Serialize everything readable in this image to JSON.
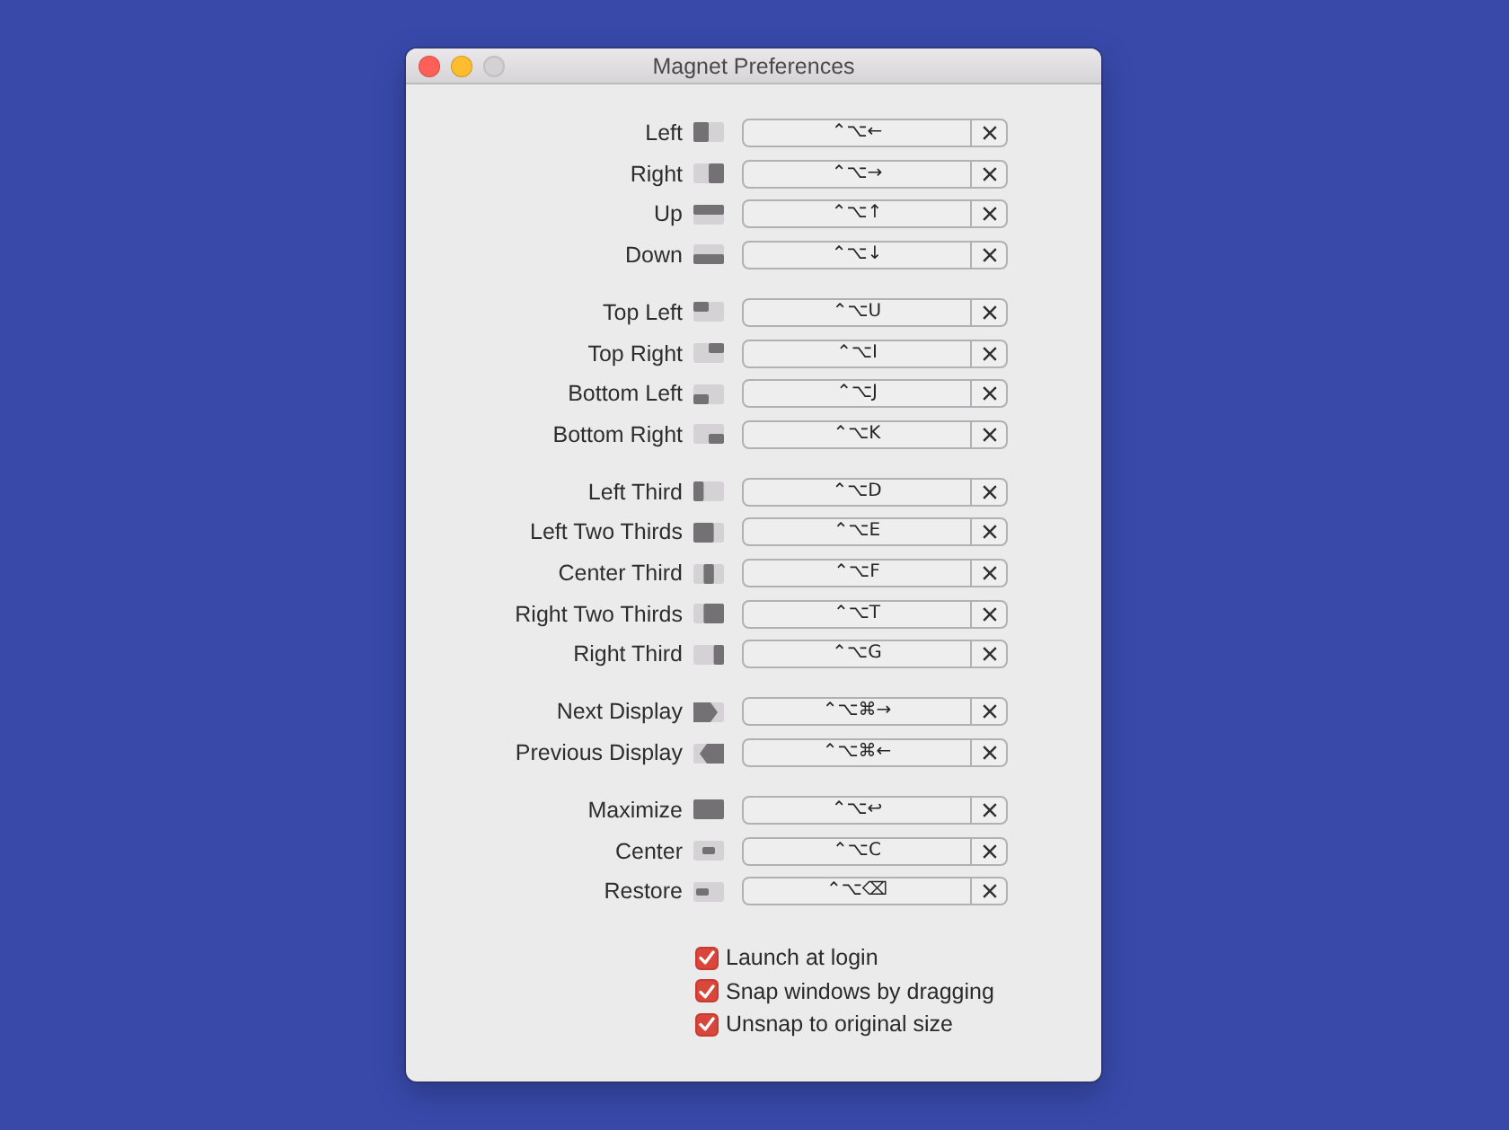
{
  "window": {
    "title": "Magnet Preferences",
    "controls": [
      {
        "kind": "close",
        "disabled": false
      },
      {
        "kind": "minimize",
        "disabled": false
      },
      {
        "kind": "zoom",
        "disabled": true
      }
    ]
  },
  "shortcut_groups": [
    {
      "items": [
        {
          "label": "Left",
          "shortcut": "⌃⌥←"
        },
        {
          "label": "Right",
          "shortcut": "⌃⌥→"
        },
        {
          "label": "Up",
          "shortcut": "⌃⌥↑"
        },
        {
          "label": "Down",
          "shortcut": "⌃⌥↓"
        }
      ]
    },
    {
      "items": [
        {
          "label": "Top Left",
          "shortcut": "⌃⌥U"
        },
        {
          "label": "Top Right",
          "shortcut": "⌃⌥I"
        },
        {
          "label": "Bottom Left",
          "shortcut": "⌃⌥J"
        },
        {
          "label": "Bottom Right",
          "shortcut": "⌃⌥K"
        }
      ]
    },
    {
      "items": [
        {
          "label": "Left Third",
          "shortcut": "⌃⌥D"
        },
        {
          "label": "Left Two Thirds",
          "shortcut": "⌃⌥E"
        },
        {
          "label": "Center Third",
          "shortcut": "⌃⌥F"
        },
        {
          "label": "Right Two Thirds",
          "shortcut": "⌃⌥T"
        },
        {
          "label": "Right Third",
          "shortcut": "⌃⌥G"
        }
      ]
    },
    {
      "items": [
        {
          "label": "Next Display",
          "shortcut": "⌃⌥⌘→"
        },
        {
          "label": "Previous Display",
          "shortcut": "⌃⌥⌘←"
        }
      ]
    },
    {
      "items": [
        {
          "label": "Maximize",
          "shortcut": "⌃⌥↩"
        },
        {
          "label": "Center",
          "shortcut": "⌃⌥C"
        },
        {
          "label": "Restore",
          "shortcut": "⌃⌥⌫"
        }
      ]
    }
  ],
  "options": [
    {
      "label": "Launch at login",
      "checked": true
    },
    {
      "label": "Snap windows by dragging",
      "checked": true
    },
    {
      "label": "Unsnap to original size",
      "checked": true
    }
  ]
}
